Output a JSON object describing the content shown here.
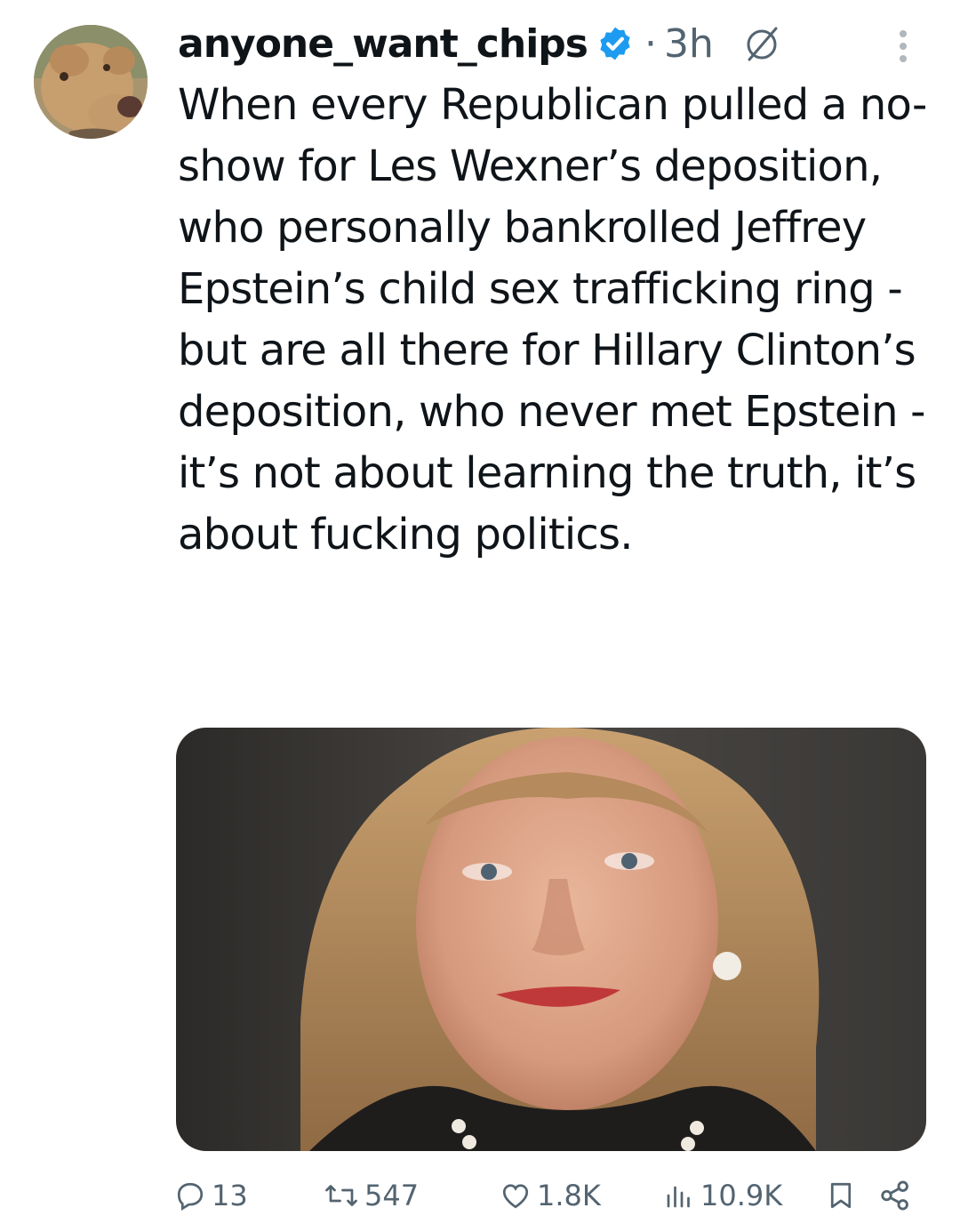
{
  "post": {
    "username": "anyone_want_chips",
    "separator": "·",
    "time": "3h",
    "text": "When every Republican pulled a no-show for Les Wexner’s deposition, who personally bankrolled Jeffrey Epstein’s child sex trafficking ring - but are all there for Hillary Clinton’s deposition, who never met Epstein - it’s not about learning the truth, it’s about fucking politics.",
    "avatar_icon": "dog-avatar",
    "media_description_icon": "portrait-photo"
  },
  "actions": {
    "replies": "13",
    "reposts": "547",
    "likes": "1.8K",
    "views": "10.9K"
  },
  "colors": {
    "verified": "#1d9bf0",
    "muted": "#536471",
    "text": "#0f1419"
  }
}
